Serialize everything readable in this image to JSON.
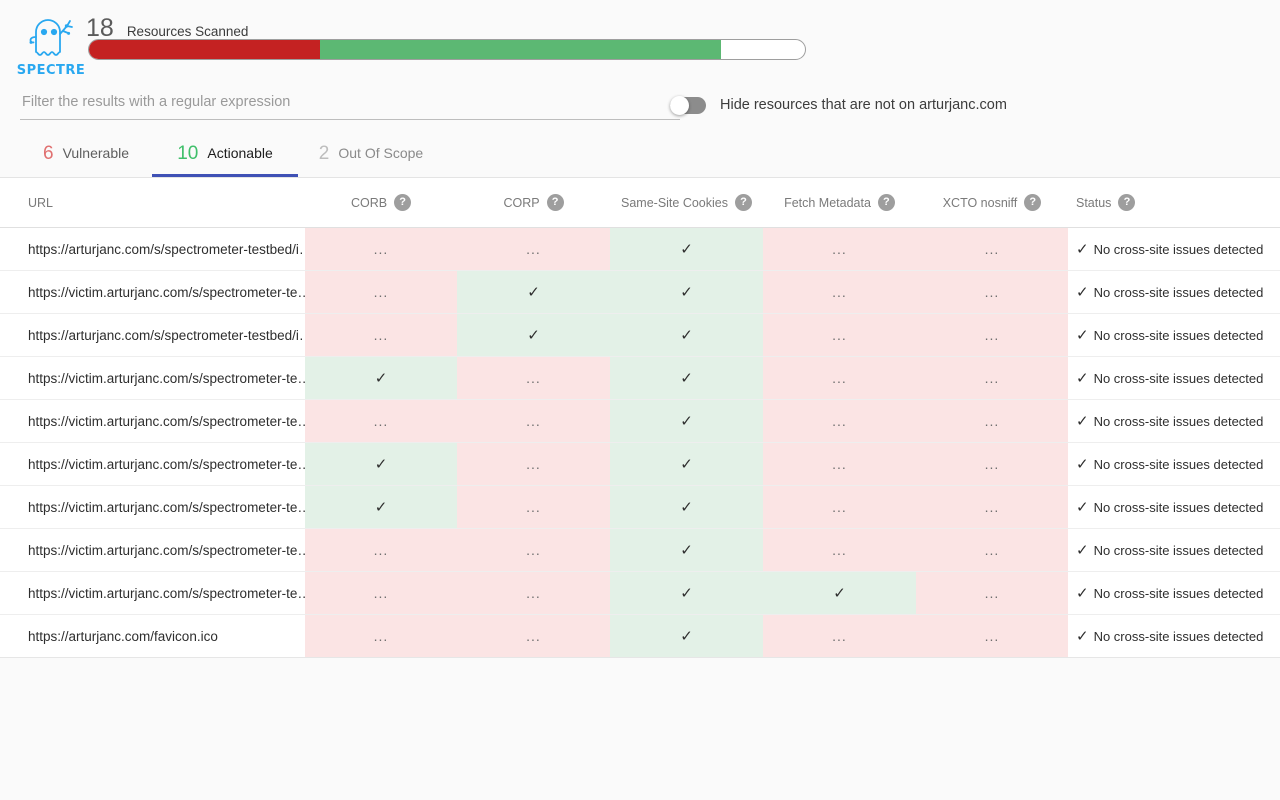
{
  "app": {
    "logo_word": "SPECTRE",
    "logo_icon": "spectre-ghost-logo"
  },
  "scan": {
    "count": "18",
    "label": "Resources Scanned",
    "progress": {
      "red_pct": 32.3,
      "green_pct": 56.0,
      "empty_pct": 11.7,
      "red_color": "#C42222",
      "green_color": "#5CB873"
    }
  },
  "filter": {
    "placeholder": "Filter the results with a regular expression",
    "value": ""
  },
  "toggle": {
    "label": "Hide resources that are not on arturjanc.com",
    "state": "off"
  },
  "tabs": [
    {
      "count": "6",
      "label": "Vulnerable",
      "active": false
    },
    {
      "count": "10",
      "label": "Actionable",
      "active": true
    },
    {
      "count": "2",
      "label": "Out Of Scope",
      "active": false
    }
  ],
  "table": {
    "columns": [
      {
        "key": "url",
        "label": "URL",
        "help": false
      },
      {
        "key": "corb",
        "label": "CORB",
        "help": true,
        "help_glyph": "?"
      },
      {
        "key": "corp",
        "label": "CORP",
        "help": true,
        "help_glyph": "?"
      },
      {
        "key": "ssc",
        "label": "Same-Site Cookies",
        "help": true,
        "help_glyph": "?"
      },
      {
        "key": "fm",
        "label": "Fetch Metadata",
        "help": true,
        "help_glyph": "?"
      },
      {
        "key": "xcto",
        "label": "XCTO nosniff",
        "help": true,
        "help_glyph": "?"
      },
      {
        "key": "status",
        "label": "Status",
        "help": true,
        "help_glyph": "?"
      }
    ],
    "check_glyph": "✓",
    "dots_glyph": "...",
    "status_text": "No cross-site issues detected",
    "rows": [
      {
        "url": "https://arturjanc.com/s/spectrometer-testbed/i…",
        "corb": "bad",
        "corp": "bad",
        "ssc": "ok",
        "fm": "bad",
        "xcto": "bad"
      },
      {
        "url": "https://victim.arturjanc.com/s/spectrometer-te…",
        "corb": "bad",
        "corp": "ok",
        "ssc": "ok",
        "fm": "bad",
        "xcto": "bad"
      },
      {
        "url": "https://arturjanc.com/s/spectrometer-testbed/i…",
        "corb": "bad",
        "corp": "ok",
        "ssc": "ok",
        "fm": "bad",
        "xcto": "bad"
      },
      {
        "url": "https://victim.arturjanc.com/s/spectrometer-te…",
        "corb": "ok",
        "corp": "bad",
        "ssc": "ok",
        "fm": "bad",
        "xcto": "bad"
      },
      {
        "url": "https://victim.arturjanc.com/s/spectrometer-te…",
        "corb": "bad",
        "corp": "bad",
        "ssc": "ok",
        "fm": "bad",
        "xcto": "bad"
      },
      {
        "url": "https://victim.arturjanc.com/s/spectrometer-te…",
        "corb": "ok",
        "corp": "bad",
        "ssc": "ok",
        "fm": "bad",
        "xcto": "bad"
      },
      {
        "url": "https://victim.arturjanc.com/s/spectrometer-te…",
        "corb": "ok",
        "corp": "bad",
        "ssc": "ok",
        "fm": "bad",
        "xcto": "bad"
      },
      {
        "url": "https://victim.arturjanc.com/s/spectrometer-te…",
        "corb": "bad",
        "corp": "bad",
        "ssc": "ok",
        "fm": "bad",
        "xcto": "bad"
      },
      {
        "url": "https://victim.arturjanc.com/s/spectrometer-te…",
        "corb": "bad",
        "corp": "bad",
        "ssc": "ok",
        "fm": "ok",
        "xcto": "bad"
      },
      {
        "url": "https://arturjanc.com/favicon.ico",
        "corb": "bad",
        "corp": "bad",
        "ssc": "ok",
        "fm": "bad",
        "xcto": "bad"
      }
    ]
  }
}
